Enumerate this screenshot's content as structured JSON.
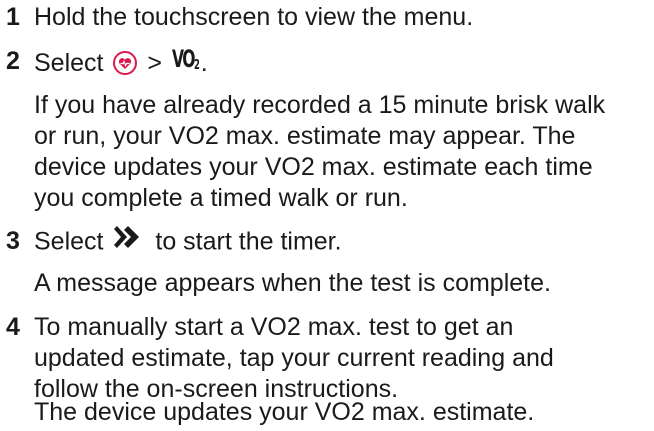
{
  "steps": [
    {
      "number": "1",
      "lines": [
        "Hold the touchscreen to view the menu."
      ]
    },
    {
      "number": "2",
      "prefix": "Select",
      "separator": ">",
      "vo2_label": "VO",
      "vo2_sub": "2",
      "suffix": ".",
      "detail": [
        "If you have already recorded a 15 minute brisk walk",
        "or run, your VO2 max. estimate may appear. The",
        "device updates your VO2 max. estimate each time",
        "you complete a timed walk or run."
      ],
      "icons": [
        "heart-rate-icon",
        "vo2-icon"
      ],
      "heart_color": "#d81b4c"
    },
    {
      "number": "3",
      "prefix": "Select",
      "suffix": "to start the timer.",
      "detail": [
        "A message appears when the test is complete."
      ],
      "icons": [
        "double-chevron-right-icon"
      ]
    },
    {
      "number": "4",
      "lines": [
        "To manually start a VO2 max. test to get an",
        "updated estimate, tap your current reading and",
        "follow the on-screen instructions."
      ],
      "detail": [
        "The device updates your VO2 max. estimate."
      ]
    }
  ]
}
